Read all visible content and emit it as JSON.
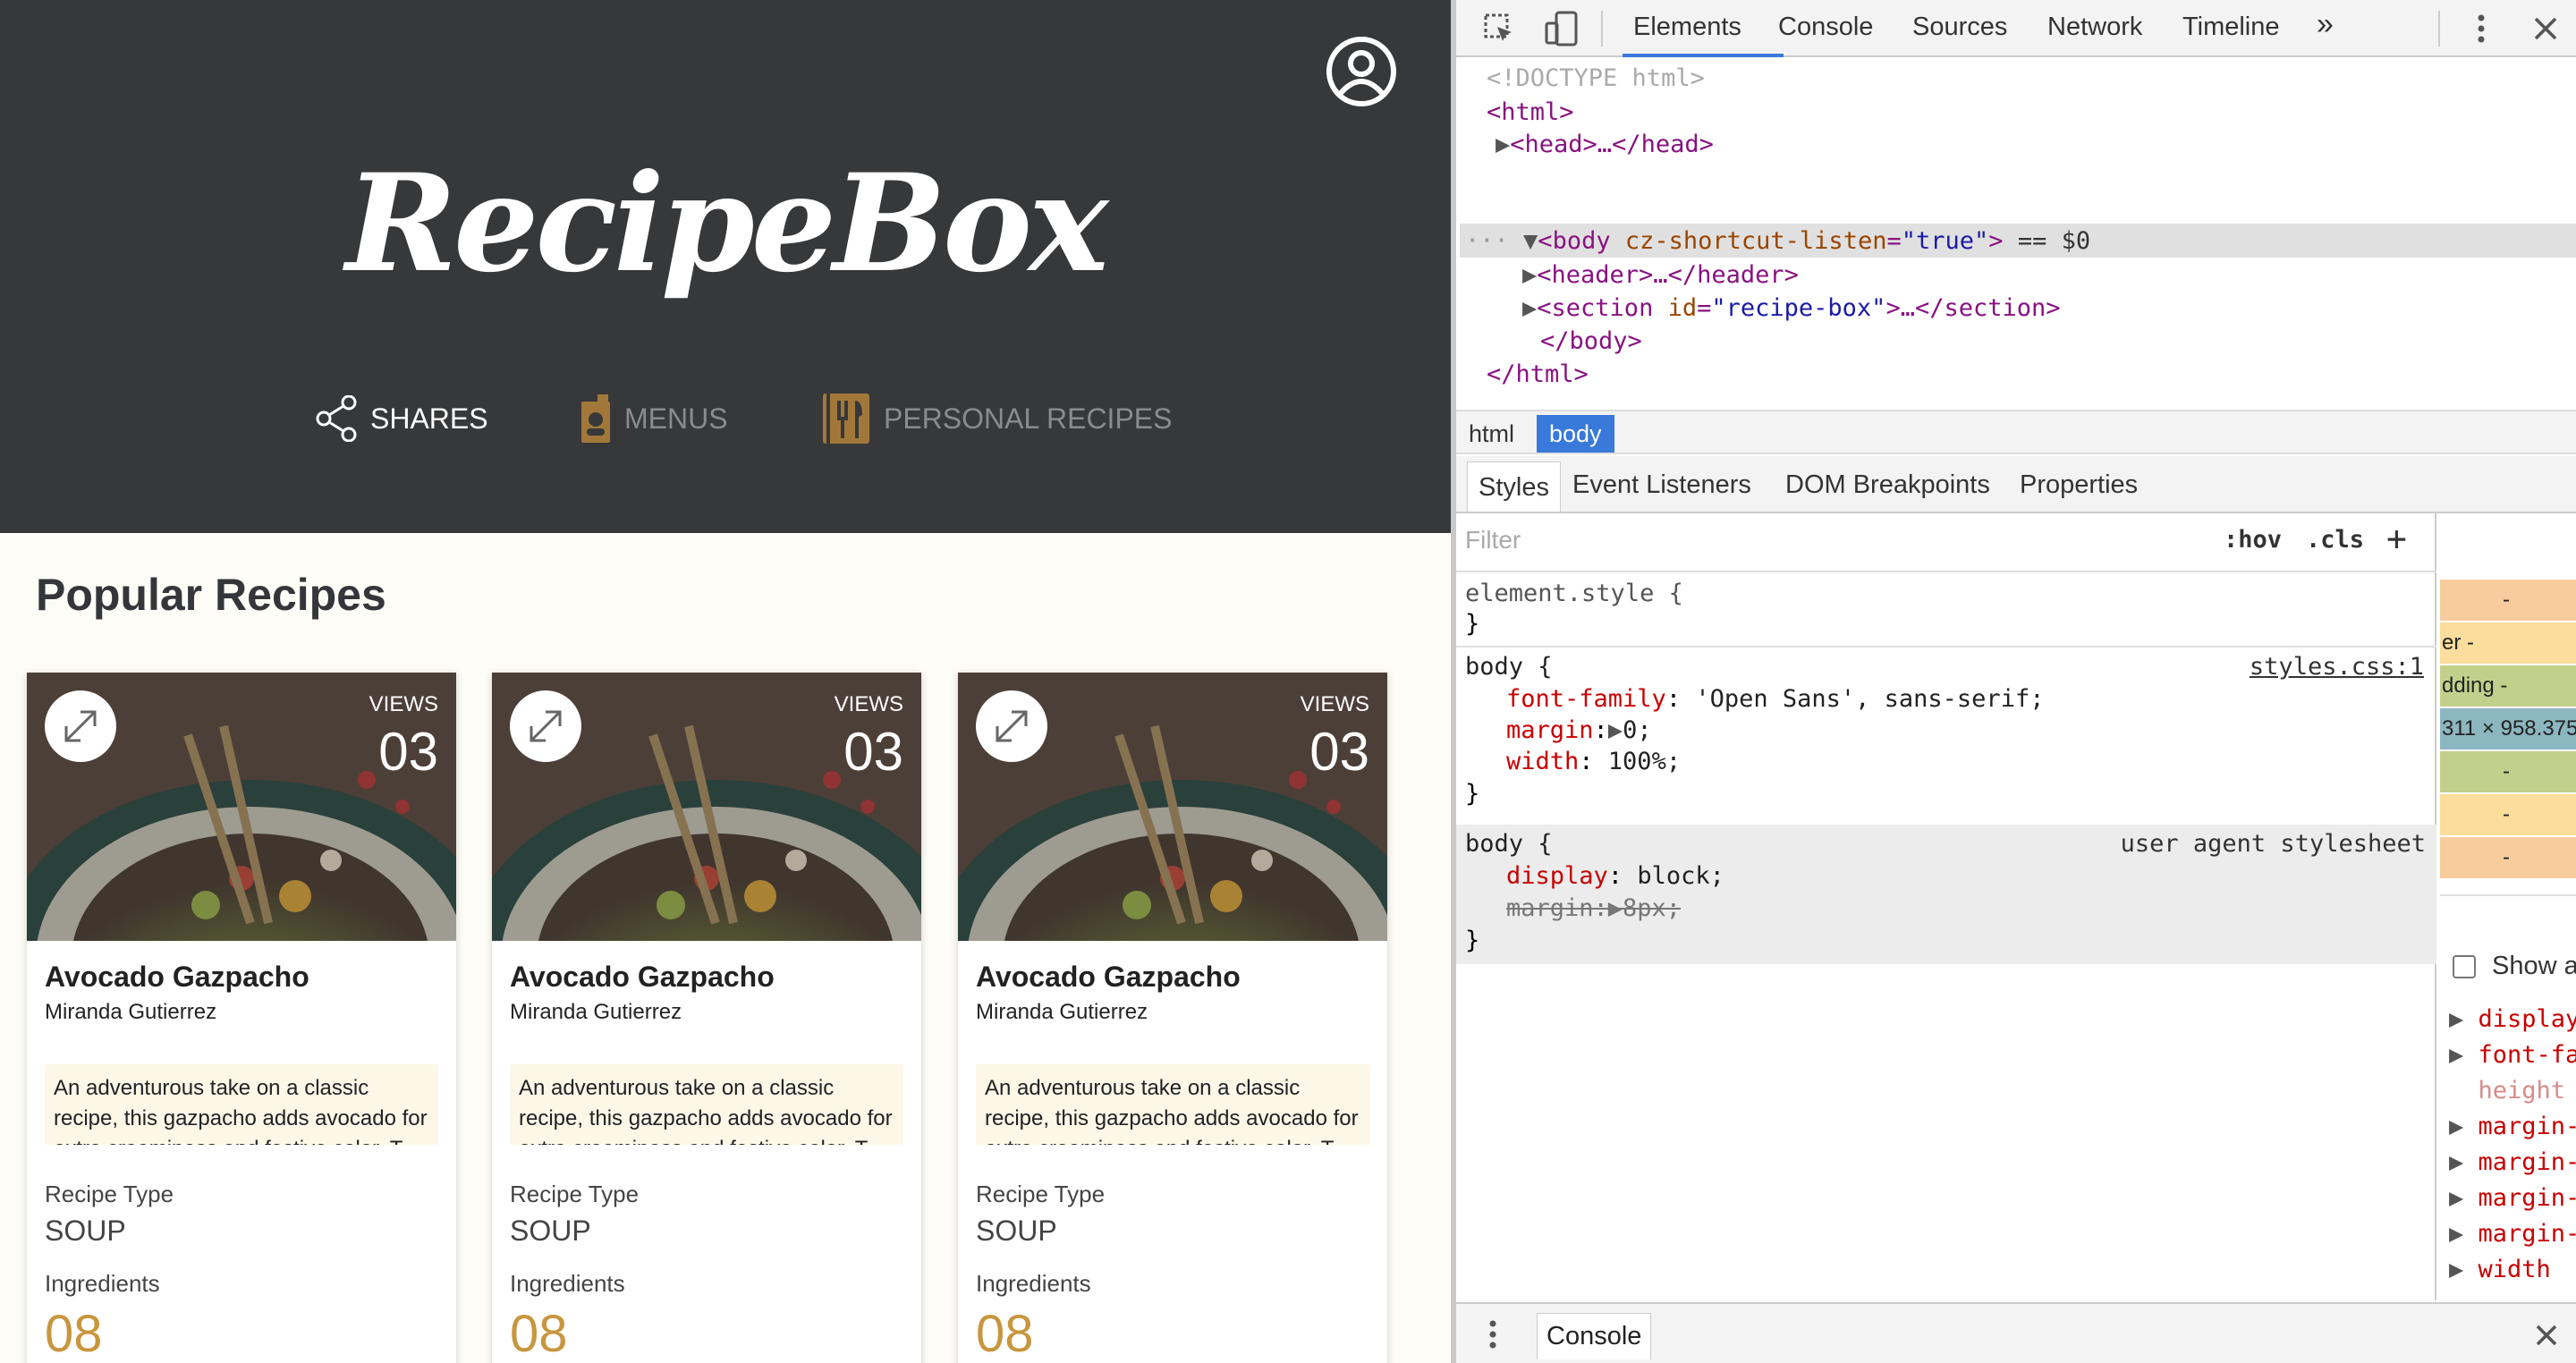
{
  "app": {
    "logo_text": "RecipeBox",
    "nav": [
      {
        "label": "SHARES"
      },
      {
        "label": "MENUS"
      },
      {
        "label": "PERSONAL RECIPES"
      }
    ],
    "section_title": "Popular Recipes",
    "cards": [
      {
        "views_label": "VIEWS",
        "views": "03",
        "title": "Avocado Gazpacho",
        "author": "Miranda Gutierrez",
        "description": "An adventurous take on a classic recipe, this gazpacho adds avocado for extra creaminess and festive color. T",
        "type_label": "Recipe Type",
        "type": "SOUP",
        "ingredients_label": "Ingredients",
        "ingredients": "08"
      },
      {
        "views_label": "VIEWS",
        "views": "03",
        "title": "Avocado Gazpacho",
        "author": "Miranda Gutierrez",
        "description": "An adventurous take on a classic recipe, this gazpacho adds avocado for extra creaminess and festive color. T",
        "type_label": "Recipe Type",
        "type": "SOUP",
        "ingredients_label": "Ingredients",
        "ingredients": "08"
      },
      {
        "views_label": "VIEWS",
        "views": "03",
        "title": "Avocado Gazpacho",
        "author": "Miranda Gutierrez",
        "description": "An adventurous take on a classic recipe, this gazpacho adds avocado for extra creaminess and festive color. T",
        "type_label": "Recipe Type",
        "type": "SOUP",
        "ingredients_label": "Ingredients",
        "ingredients": "08"
      }
    ],
    "colors": {
      "header_bg": "#37383a",
      "page_bg": "#fdfcf7",
      "accent": "#c8963e",
      "desc_bg": "#fdf7e8"
    }
  },
  "devtools": {
    "tabs": [
      "Elements",
      "Console",
      "Sources",
      "Network",
      "Timeline"
    ],
    "more_tabs": "»",
    "dom": {
      "doctype": "<!DOCTYPE html>",
      "html_open": "<html>",
      "head": "<head>…</head>",
      "body_tag": "body",
      "body_attr": "cz-shortcut-listen",
      "body_attr_val": "\"true\"",
      "body_suffix": "== $0",
      "header": "<header>…</header>",
      "section_tag": "section",
      "section_attr": "id",
      "section_attr_val": "\"recipe-box\"",
      "section_suffix": "…</section>",
      "body_close": "</body>",
      "html_close": "</html>"
    },
    "breadcrumbs": [
      "html",
      "body"
    ],
    "subtabs": [
      "Styles",
      "Event Listeners",
      "DOM Breakpoints",
      "Properties"
    ],
    "filter_placeholder": "Filter",
    "hov": ":hov",
    "cls": ".cls",
    "add": "+",
    "rules": {
      "element_style": "element.style {",
      "close": "}",
      "body_sel": "body {",
      "body_src": "styles.css:1",
      "p1_name": "font-family",
      "p1_val": "'Open Sans', sans-serif;",
      "p2_name": "margin",
      "p2_val": "0;",
      "p3_name": "width",
      "p3_val": "100%;",
      "ua_sel": "body {",
      "ua_src": "user agent stylesheet",
      "ua1_name": "display",
      "ua1_val": "block;",
      "ua2": "margin:▶8px;"
    },
    "boxmodel": [
      "-",
      "er   -",
      "dding -",
      "311 × 958.375",
      "-",
      "-",
      "-"
    ],
    "show_all_label": "Show a",
    "computed": [
      "display",
      "font-fa",
      "height",
      "margin-",
      "margin-",
      "margin-",
      "margin-",
      "width"
    ],
    "drawer_tab": "Console"
  }
}
